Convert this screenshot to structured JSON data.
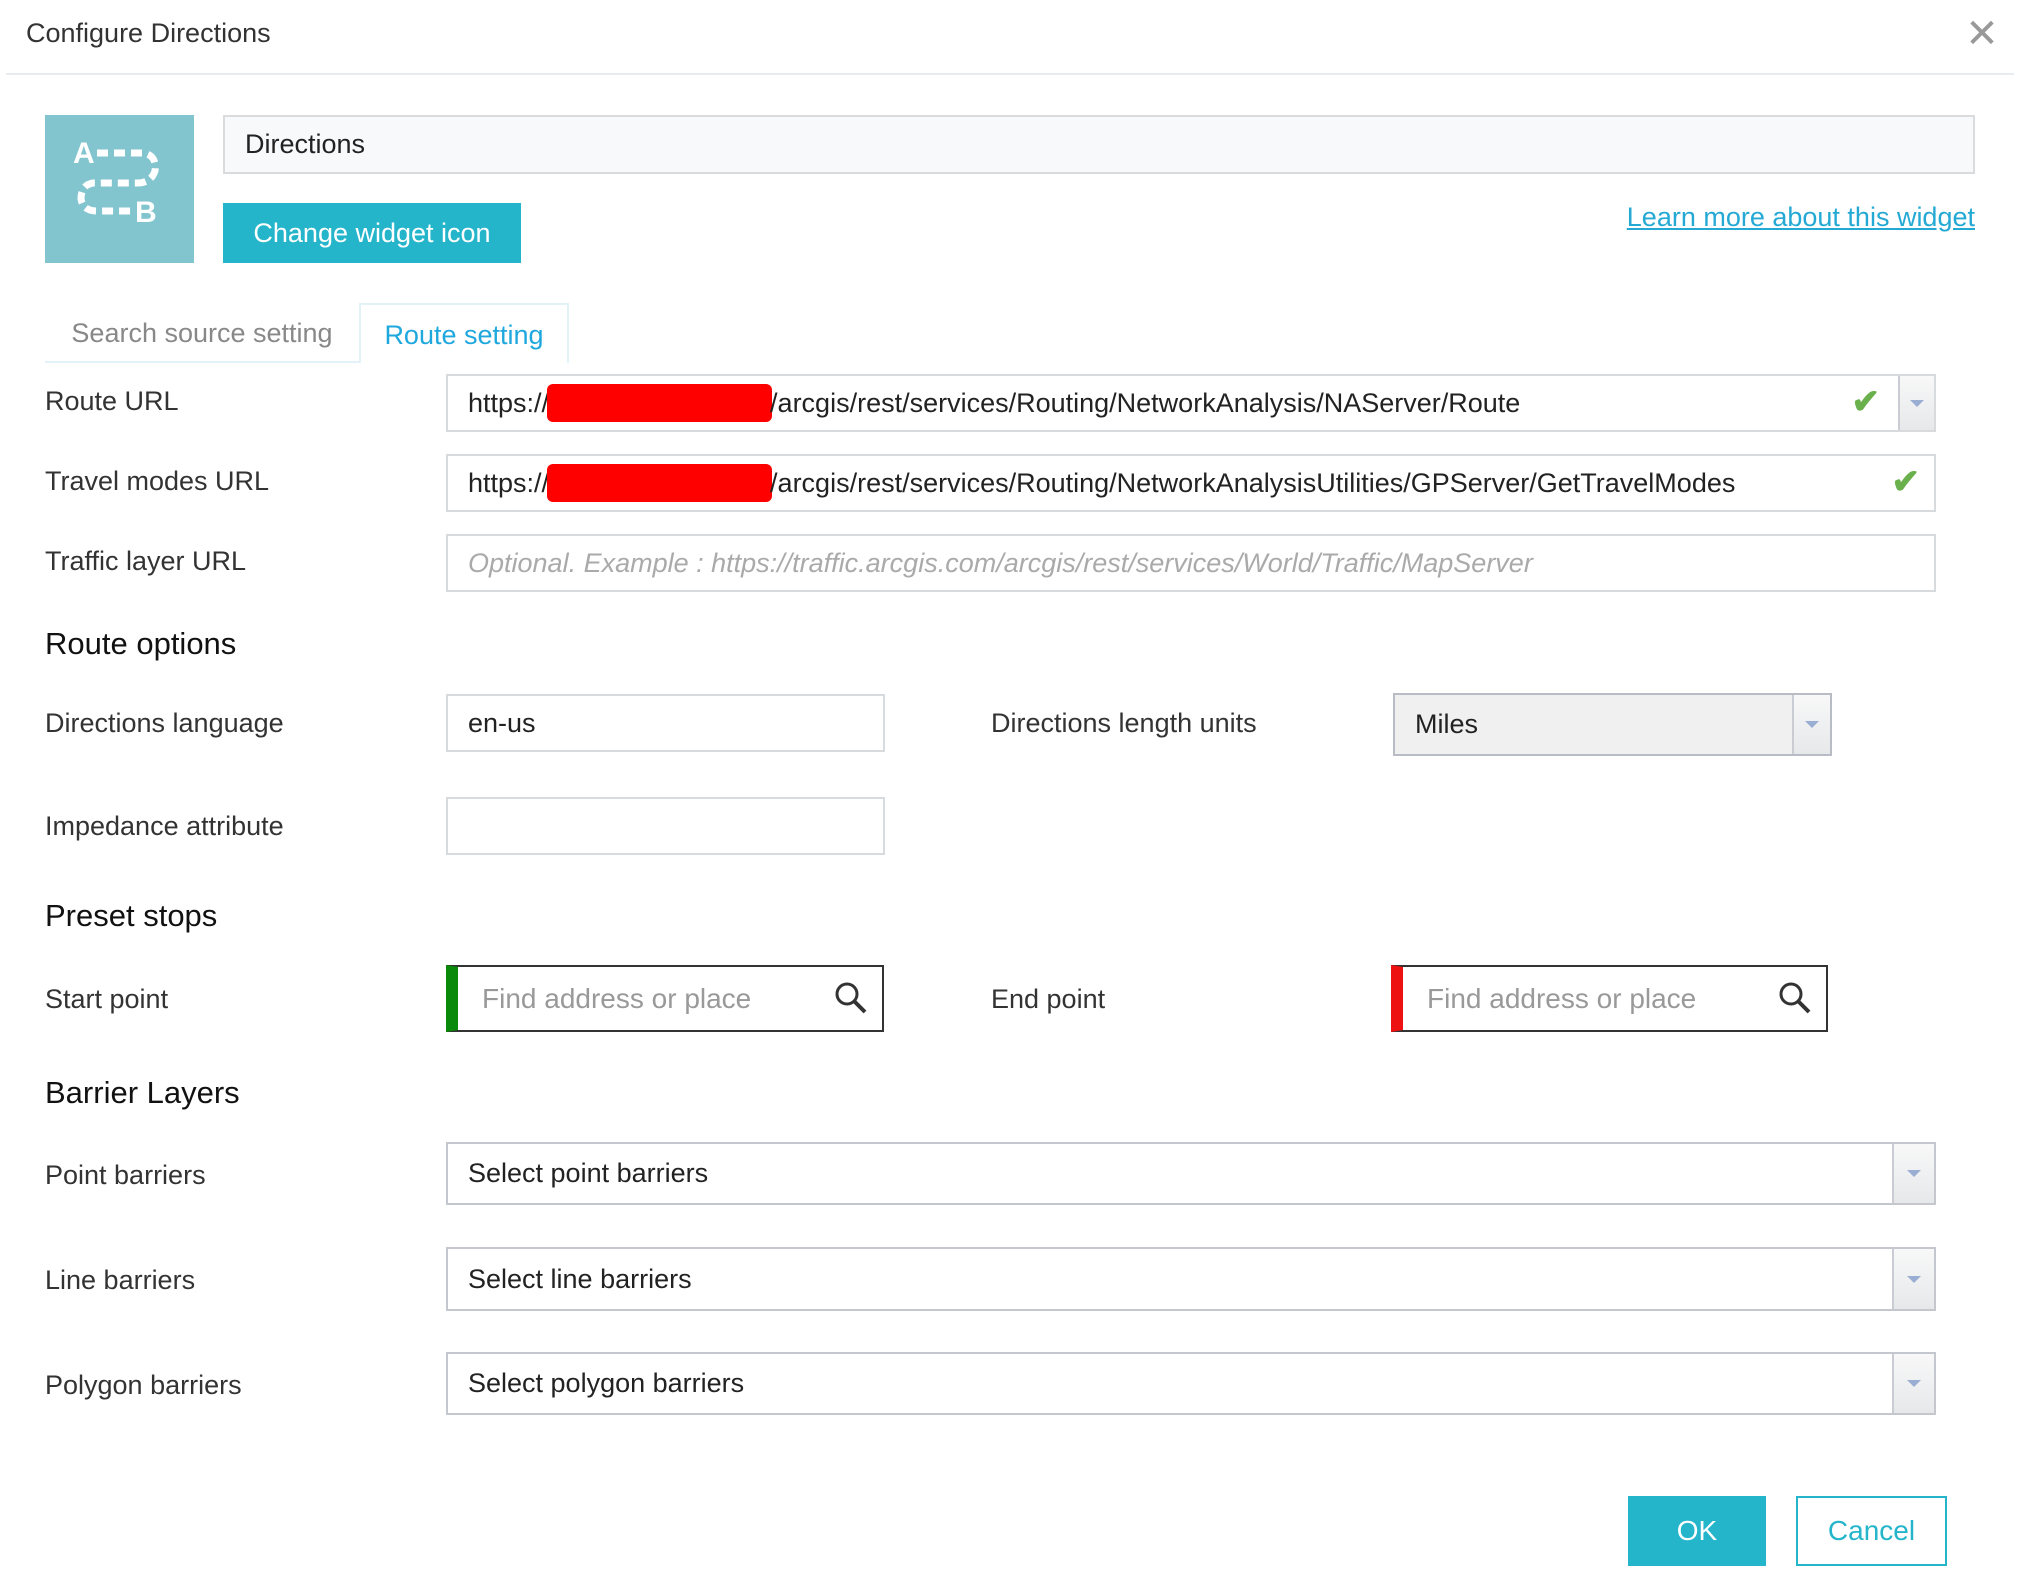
{
  "dialog": {
    "title": "Configure Directions",
    "close_icon": "close-icon"
  },
  "widget": {
    "name": "Directions",
    "icon": "directions-a-to-b-icon",
    "change_icon_label": "Change widget icon",
    "learn_more": "Learn more about this widget"
  },
  "tabs": [
    {
      "label": "Search source setting",
      "active": false
    },
    {
      "label": "Route setting",
      "active": true
    }
  ],
  "route_url": {
    "label": "Route URL",
    "prefix": "https://",
    "suffix": "/arcgis/rest/services/Routing/NetworkAnalysis/NAServer/Route",
    "valid": true
  },
  "travel_modes_url": {
    "label": "Travel modes URL",
    "prefix": "https://",
    "suffix": "/arcgis/rest/services/Routing/NetworkAnalysisUtilities/GPServer/GetTravelModes",
    "valid": true
  },
  "traffic_url": {
    "label": "Traffic layer URL",
    "placeholder": "Optional. Example : https://traffic.arcgis.com/arcgis/rest/services/World/Traffic/MapServer",
    "value": ""
  },
  "route_options": {
    "heading": "Route options",
    "language_label": "Directions language",
    "language_value": "en-us",
    "units_label": "Directions length units",
    "units_value": "Miles",
    "impedance_label": "Impedance attribute",
    "impedance_value": ""
  },
  "preset_stops": {
    "heading": "Preset stops",
    "start_label": "Start point",
    "start_placeholder": "Find address or place",
    "start_color": "#0a8a0a",
    "end_label": "End point",
    "end_placeholder": "Find address or place",
    "end_color": "#ee1111"
  },
  "barriers": {
    "heading": "Barrier Layers",
    "point_label": "Point barriers",
    "point_value": "Select point barriers",
    "line_label": "Line barriers",
    "line_value": "Select line barriers",
    "polygon_label": "Polygon barriers",
    "polygon_value": "Select polygon barriers"
  },
  "footer": {
    "ok": "OK",
    "cancel": "Cancel"
  },
  "colors": {
    "accent": "#24b5cb",
    "valid": "#6ab04c"
  }
}
